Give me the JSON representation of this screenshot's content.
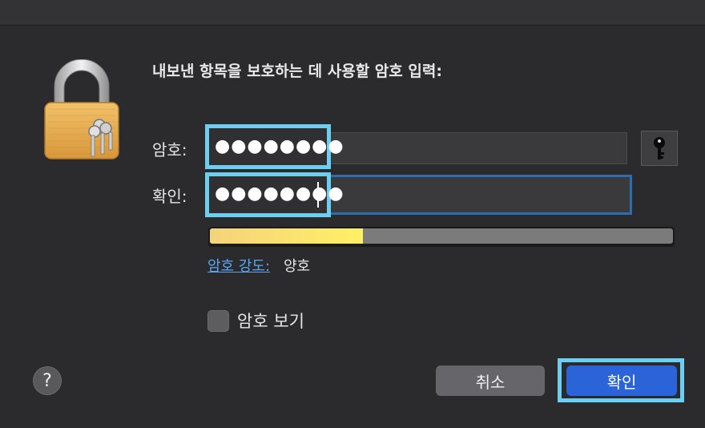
{
  "dialog": {
    "prompt": "내보낸 항목을 보호하는 데 사용할 암호 입력:",
    "password": {
      "label": "암호:",
      "value": "●●●●●●●●"
    },
    "confirm": {
      "label": "확인:",
      "value": "●●●●●●●●"
    },
    "strength": {
      "link_label": "암호 강도:",
      "value_label": "양호",
      "level": 0.33
    },
    "show_password": {
      "label": "암호 보기",
      "checked": false
    },
    "buttons": {
      "help": "?",
      "cancel": "취소",
      "ok": "확인"
    },
    "colors": {
      "accent": "#2a64d8",
      "highlight": "#6ccff2",
      "link": "#5aa6f5"
    },
    "icons": {
      "lock": "lock-icon",
      "key": "key-icon"
    }
  }
}
